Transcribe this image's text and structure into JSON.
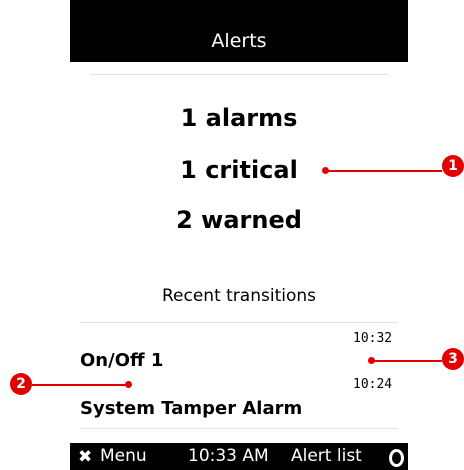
{
  "header": {
    "title": "Alerts"
  },
  "summary": {
    "alarms": "1 alarms",
    "critical": "1 critical",
    "warned": "2 warned"
  },
  "recent": {
    "title": "Recent transitions",
    "items": [
      {
        "time": "10:32",
        "name": "On/Off 1"
      },
      {
        "time": "10:24",
        "name": "System Tamper Alarm"
      }
    ]
  },
  "footer": {
    "left_icon": "x-icon",
    "left_label": "Menu",
    "time": "10:33 AM",
    "right_label": "Alert list",
    "right_icon": "o-icon"
  },
  "callouts": [
    "1",
    "2",
    "3"
  ],
  "colors": {
    "callout": "#e00000",
    "bar": "#000000"
  }
}
